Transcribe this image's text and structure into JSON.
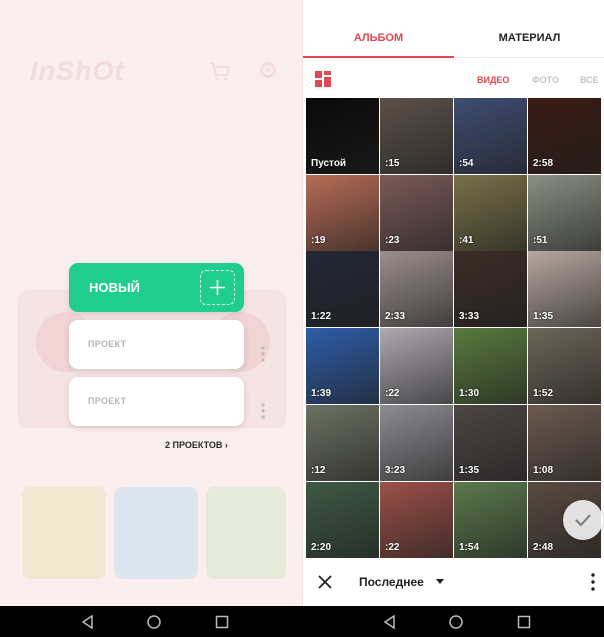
{
  "home": {
    "logo": "InShOt",
    "new_button_label": "НОВЫЙ",
    "projects": [
      {
        "label": "ПРОЕКТ"
      },
      {
        "label": "ПРОЕКТ"
      }
    ],
    "projects_link": "2 ПРОЕКТОВ ›"
  },
  "picker": {
    "tabs": {
      "album": "АЛЬБОМ",
      "material": "МАТЕРИАЛ"
    },
    "filters": {
      "video": "ВИДЕО",
      "photo": "ФОТО",
      "all": "ВСЕ"
    },
    "cells": [
      {
        "label": "Пустой",
        "color": "#0a0a0a"
      },
      {
        "label": ":15",
        "color": "#5b5148"
      },
      {
        "label": ":54",
        "color": "#3d4d72"
      },
      {
        "label": "2:58",
        "color": "#3a1c12"
      },
      {
        "label": ":19",
        "color": "#b76c56"
      },
      {
        "label": ":23",
        "color": "#7a5a58"
      },
      {
        "label": ":41",
        "color": "#787048"
      },
      {
        "label": ":51",
        "color": "#8a8f84"
      },
      {
        "label": "1:22",
        "color": "#232836"
      },
      {
        "label": "2:33",
        "color": "#9b8f8c"
      },
      {
        "label": "3:33",
        "color": "#3b2c26"
      },
      {
        "label": "1:35",
        "color": "#b7a8a0"
      },
      {
        "label": "1:39",
        "color": "#2e5da8"
      },
      {
        "label": ":22",
        "color": "#aeaab0"
      },
      {
        "label": "1:30",
        "color": "#587a3e"
      },
      {
        "label": "1:52",
        "color": "#6c6558"
      },
      {
        "label": ":12",
        "color": "#6c7262"
      },
      {
        "label": "3:23",
        "color": "#8e8c90"
      },
      {
        "label": "1:35",
        "color": "#4c4644"
      },
      {
        "label": "1:08",
        "color": "#6c5a50"
      },
      {
        "label": "2:20",
        "color": "#3e5a44"
      },
      {
        "label": ":22",
        "color": "#9c5048"
      },
      {
        "label": "1:54",
        "color": "#5a7a4c"
      },
      {
        "label": "2:48",
        "color": "#5a4a42"
      }
    ],
    "bottom": {
      "recent_label": "Последнее"
    }
  },
  "colors": {
    "accent_red": "#e2474f",
    "accent_green": "#1fce8c"
  }
}
